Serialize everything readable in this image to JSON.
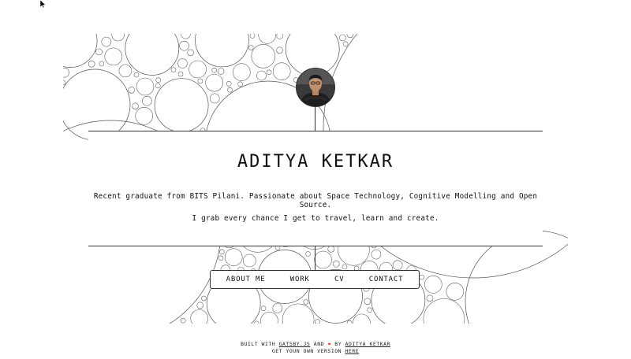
{
  "profile": {
    "name": "ADITYA KETKAR",
    "bio_line1": "Recent graduate from BITS Pilani. Passionate about Space Technology, Cognitive Modelling and Open Source.",
    "bio_line2": "I grab every chance I get to travel, learn and create."
  },
  "nav": {
    "items": [
      "ABOUT ME",
      "WORK",
      "CV",
      "CONTACT"
    ]
  },
  "footer": {
    "built_with": "BUILT WITH",
    "framework": "GATSBY.JS",
    "and": "AND",
    "heart": "❤",
    "by": "BY",
    "author": "ADITYA KETKAR",
    "get_own": "GET YOUN OWN VERSION",
    "here": "HERE"
  },
  "colors": {
    "line": "#333333",
    "heart": "#d94040",
    "background": "#ffffff"
  },
  "icons": {
    "cursor": "mouse-pointer-icon",
    "avatar": "profile-photo"
  }
}
